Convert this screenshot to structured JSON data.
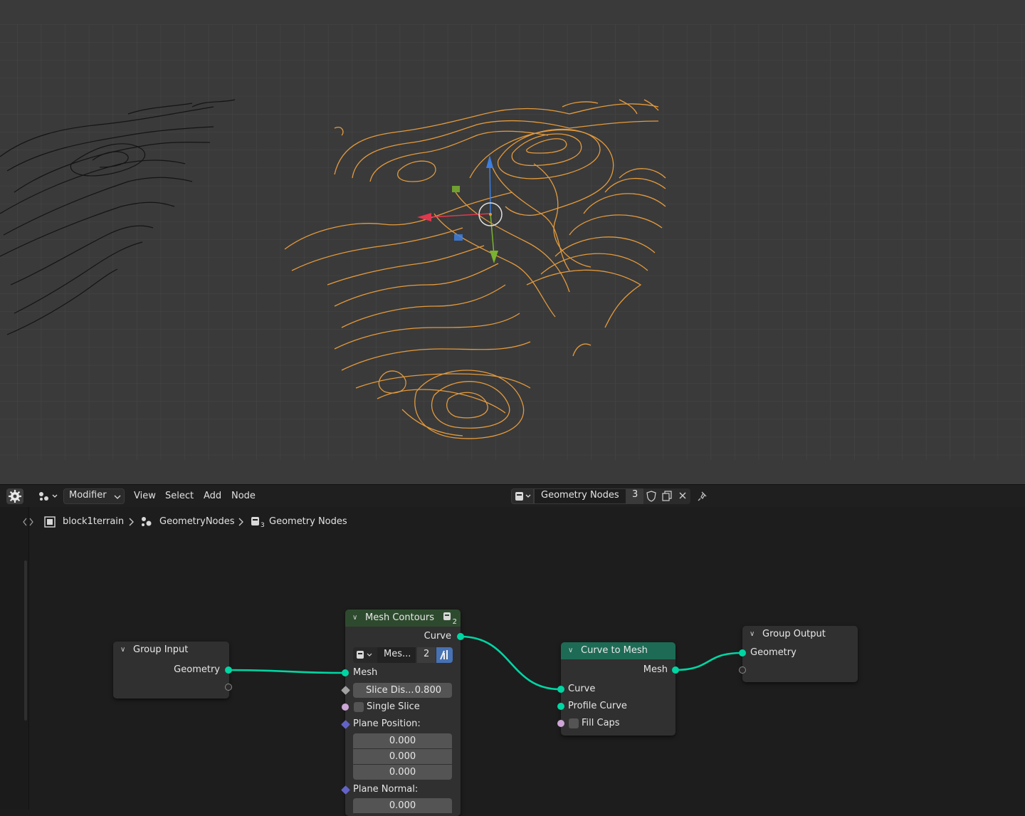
{
  "header": {
    "editor_type": "Modifier",
    "menus": [
      "View",
      "Select",
      "Add",
      "Node"
    ],
    "node_group_name": "Geometry Nodes",
    "user_count": "3"
  },
  "breadcrumb": {
    "object": "block1terrain",
    "modifier": "GeometryNodes",
    "node_group": "Geometry Nodes",
    "node_group_sub": "3"
  },
  "nodes": {
    "group_input": {
      "title": "Group Input",
      "outputs": [
        "Geometry"
      ]
    },
    "mesh_contours": {
      "title": "Mesh Contours",
      "badge": "2",
      "output": "Curve",
      "selector_label": "Mes...",
      "selector_count": "2",
      "inputs": {
        "mesh": "Mesh",
        "slice_distance_label": "Slice Dis...",
        "slice_distance_value": "0.800",
        "single_slice": "Single Slice",
        "plane_position": "Plane Position:",
        "plane_position_values": [
          "0.000",
          "0.000",
          "0.000"
        ],
        "plane_normal": "Plane Normal:",
        "plane_normal_value": "0.000"
      }
    },
    "curve_to_mesh": {
      "title": "Curve to Mesh",
      "output": "Mesh",
      "inputs": [
        "Curve",
        "Profile Curve",
        "Fill Caps"
      ]
    },
    "group_output": {
      "title": "Group Output",
      "inputs": [
        "Geometry"
      ]
    }
  },
  "colors": {
    "geometry_socket": "#00d6a3",
    "boolean_socket": "#cca6d6",
    "float_socket": "#a1a1a1",
    "vector_socket": "#6363c7",
    "mesh_contours_header": "#2e4a2e",
    "curve_to_mesh_header": "#1d6b55",
    "contour_lines": "#e49a3c"
  }
}
